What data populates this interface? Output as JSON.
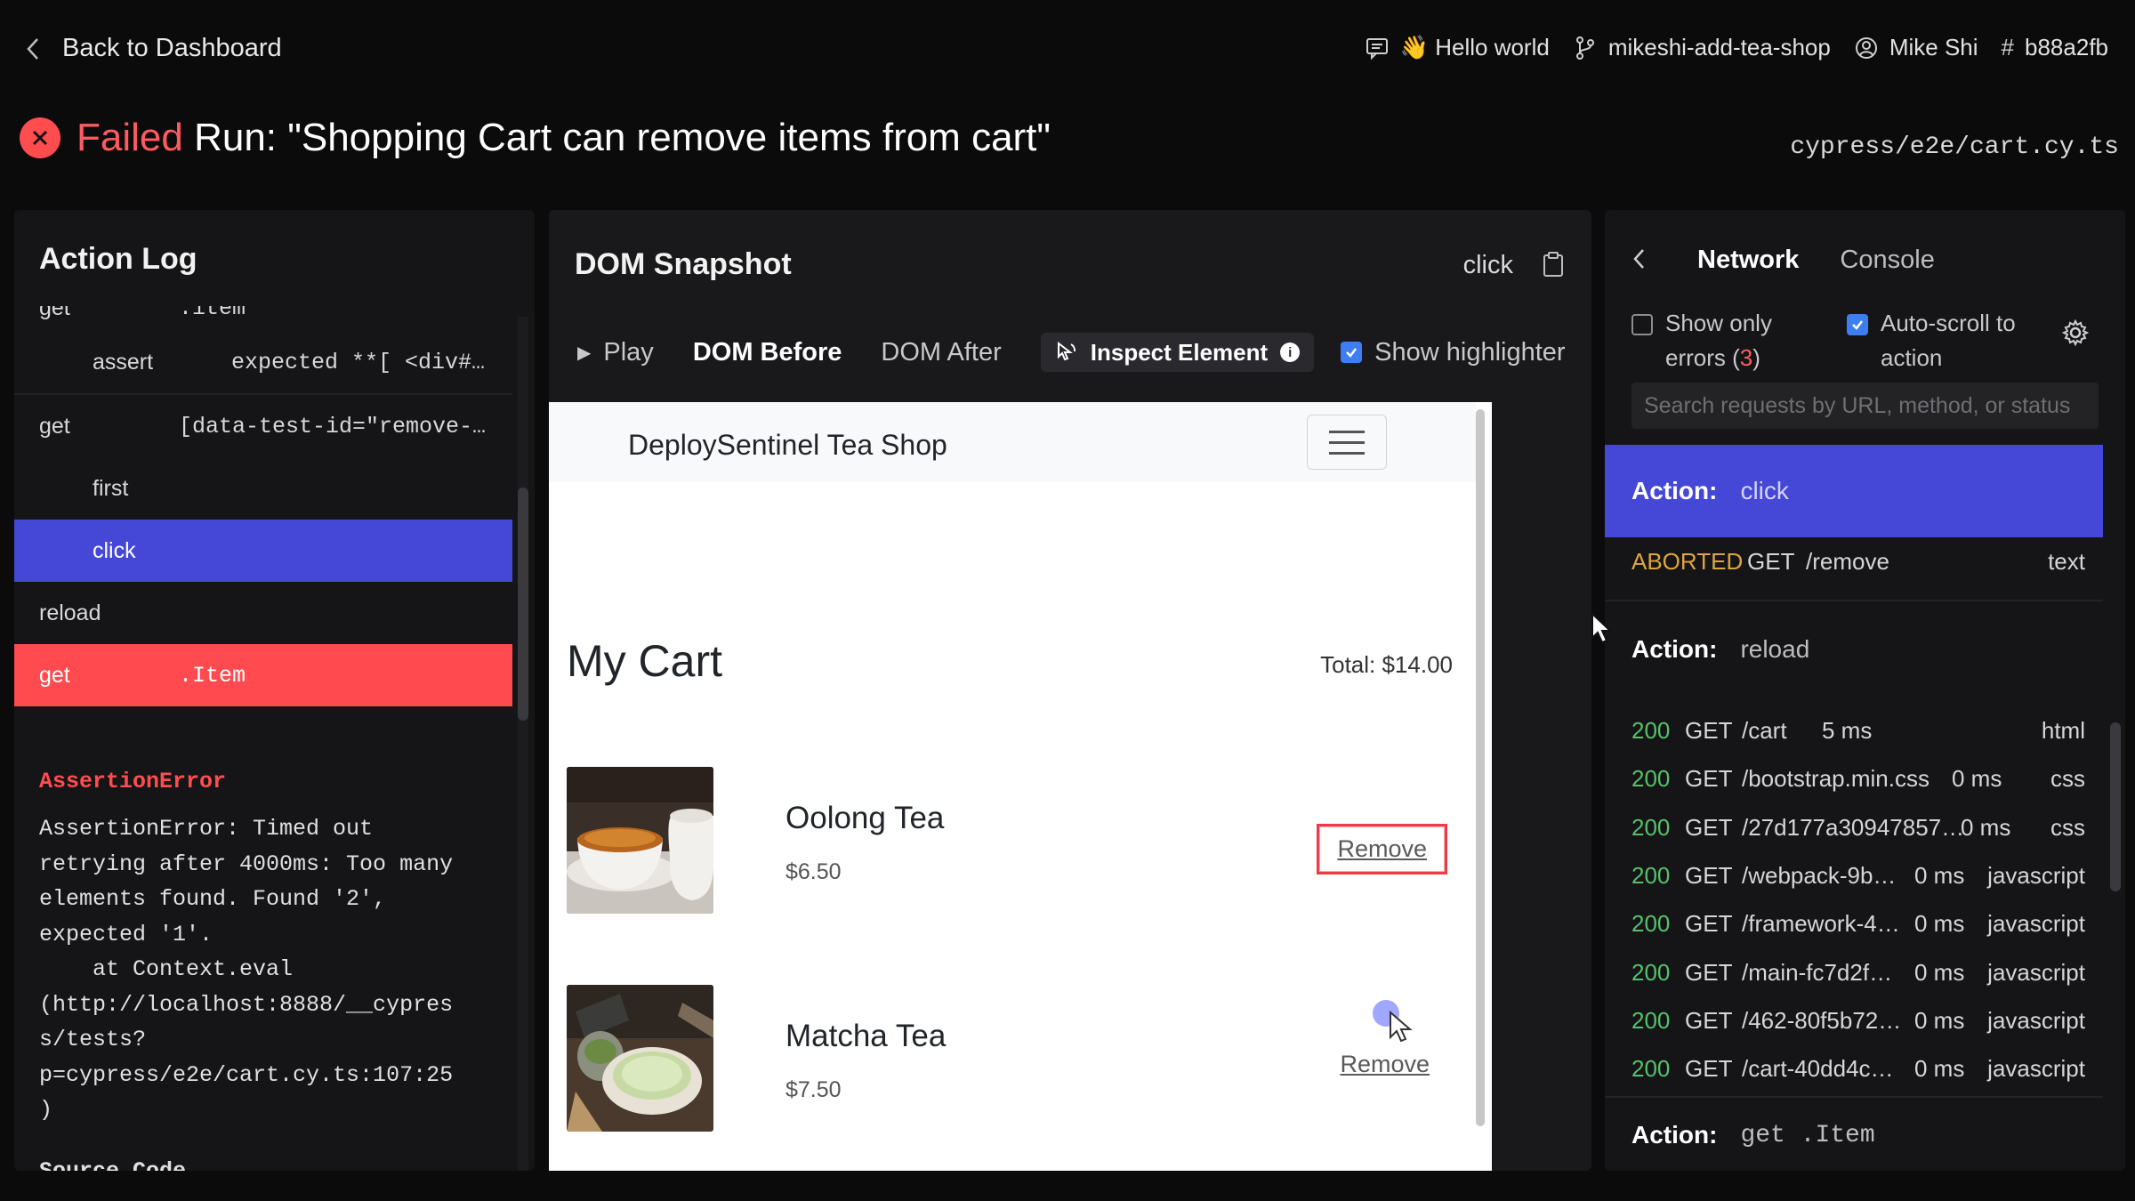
{
  "header": {
    "back_label": "Back to Dashboard",
    "commit_message": "👋 Hello world",
    "branch": "mikeshi-add-tea-shop",
    "user": "Mike Shi",
    "commit_hash": "b88a2fb"
  },
  "run": {
    "status": "Failed",
    "title_rest": "Run: \"Shopping Cart can remove items from cart\"",
    "spec_path": "cypress/e2e/cart.cy.ts",
    "status_color": "#ff4d4f"
  },
  "action_log": {
    "title": "Action Log",
    "rows": [
      {
        "cmd": "get",
        "arg": ".item"
      },
      {
        "cmd": "assert",
        "arg": "expected **[ <div#…"
      },
      {
        "cmd": "get",
        "arg": "[data-test-id=\"remove-…"
      },
      {
        "cmd": "first",
        "arg": ""
      },
      {
        "cmd": "click",
        "arg": ""
      },
      {
        "cmd": "reload",
        "arg": ""
      },
      {
        "cmd": "get",
        "arg": ".Item"
      }
    ],
    "error_title": "AssertionError",
    "error_message": "AssertionError: Timed out\nretrying after 4000ms: Too many\nelements found. Found '2',\nexpected '1'.\n    at Context.eval\n(http://localhost:8888/__cypres\ns/tests?\np=cypress/e2e/cart.cy.ts:107:25\n)",
    "source_code_label": "Source Code"
  },
  "snapshot": {
    "title": "DOM Snapshot",
    "current_action": "click",
    "tabs": {
      "play": "Play",
      "before": "DOM Before",
      "after": "DOM After",
      "inspect": "Inspect Element",
      "highlighter": "Show highlighter"
    },
    "highlighter_checked": true,
    "page": {
      "brand": "DeploySentinel Tea Shop",
      "heading": "My Cart",
      "total": "Total: $14.00",
      "items": [
        {
          "name": "Oolong Tea",
          "price": "$6.50",
          "remove": "Remove"
        },
        {
          "name": "Matcha Tea",
          "price": "$7.50",
          "remove": "Remove"
        }
      ]
    }
  },
  "network": {
    "tabs": [
      "Network",
      "Console"
    ],
    "active_tab": "Network",
    "show_only_errors_label": "Show only",
    "show_only_errors_label2": "errors (",
    "error_count": "3",
    "auto_scroll_label": "Auto-scroll to",
    "auto_scroll_label2": "action",
    "auto_scroll_checked": true,
    "search_placeholder": "Search requests by URL, method, or status",
    "action_prefix": "Action:",
    "groups": [
      {
        "action": "click",
        "requests": [
          {
            "status": "ABORTED",
            "method": "GET",
            "path": "/remove",
            "time": "",
            "type": "text"
          }
        ]
      },
      {
        "action": "reload",
        "requests": [
          {
            "status": "200",
            "method": "GET",
            "path": "/cart",
            "time": "5 ms",
            "type": "html"
          },
          {
            "status": "200",
            "method": "GET",
            "path": "/bootstrap.min.css",
            "time": "0 ms",
            "type": "css"
          },
          {
            "status": "200",
            "method": "GET",
            "path": "/27d177a30947857…",
            "time": "0 ms",
            "type": "css"
          },
          {
            "status": "200",
            "method": "GET",
            "path": "/webpack-9b…",
            "time": "0 ms",
            "type": "javascript"
          },
          {
            "status": "200",
            "method": "GET",
            "path": "/framework-4…",
            "time": "0 ms",
            "type": "javascript"
          },
          {
            "status": "200",
            "method": "GET",
            "path": "/main-fc7d2f…",
            "time": "0 ms",
            "type": "javascript"
          },
          {
            "status": "200",
            "method": "GET",
            "path": "/462-80f5b72…",
            "time": "0 ms",
            "type": "javascript"
          },
          {
            "status": "200",
            "method": "GET",
            "path": "/cart-40dd4c…",
            "time": "0 ms",
            "type": "javascript"
          }
        ]
      },
      {
        "action": "get .Item",
        "requests": []
      }
    ]
  },
  "colors": {
    "selected": "#4548d6",
    "error": "#ff4a4f",
    "ok_status": "#56c16b",
    "aborted_status": "#e0a53a"
  }
}
